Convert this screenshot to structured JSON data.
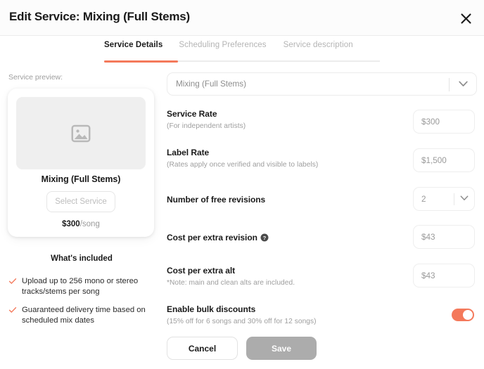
{
  "header": {
    "title": "Edit Service: Mixing (Full Stems)",
    "close_icon": "close-icon"
  },
  "tabs": [
    {
      "label": "Service Details",
      "active": true
    },
    {
      "label": "Scheduling Preferences",
      "active": false
    },
    {
      "label": "Service description",
      "active": false
    }
  ],
  "preview": {
    "label": "Service preview:",
    "thumb_icon": "image-placeholder-icon",
    "service_name": "Mixing (Full Stems)",
    "select_button": "Select Service",
    "price": "$300",
    "price_unit": "/song"
  },
  "included": {
    "title": "What's included",
    "check_icon": "check-icon",
    "items": [
      "Upload up to 256 mono or stereo tracks/stems per song",
      "Guaranteed delivery time based on scheduled mix dates"
    ]
  },
  "form": {
    "service_select": {
      "value": "Mixing (Full Stems)",
      "chevron_icon": "chevron-down-icon"
    },
    "service_rate": {
      "label": "Service Rate",
      "sub": "(For independent artists)",
      "value": "$300"
    },
    "label_rate": {
      "label": "Label Rate",
      "sub": "(Rates apply once verified and visible to labels)",
      "value": "$1,500"
    },
    "free_revisions": {
      "label": "Number of free revisions",
      "value": "2",
      "chevron_icon": "chevron-down-icon"
    },
    "cost_extra_revision": {
      "label": "Cost per extra revision",
      "help_icon": "help-circle-icon",
      "value": "$43"
    },
    "cost_extra_alt": {
      "label": "Cost per extra alt",
      "sub": "*Note: main and clean alts are included.",
      "value": "$43"
    },
    "bulk_discounts": {
      "label": "Enable bulk discounts",
      "sub": "(15% off for 6 songs and 30% off for 12 songs)",
      "toggle_on": true
    }
  },
  "footer": {
    "cancel_label": "Cancel",
    "save_label": "Save"
  },
  "colors": {
    "accent": "#f4795b",
    "save_disabled": "#acacac",
    "text": "#1a1a1a",
    "muted": "#9e9e9e"
  }
}
